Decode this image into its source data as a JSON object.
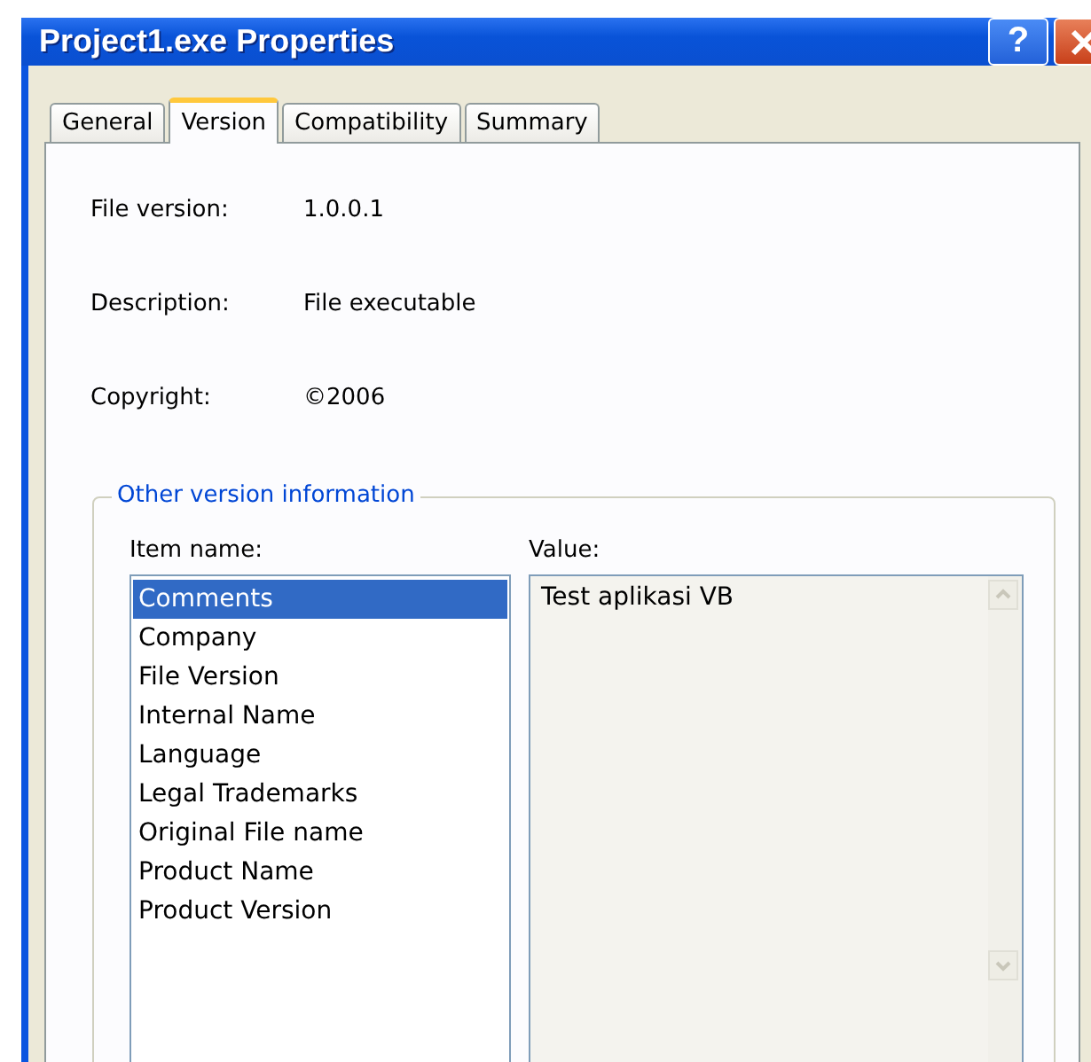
{
  "window": {
    "title": "Project1.exe Properties",
    "help_button": "?"
  },
  "tabs": [
    {
      "label": "General",
      "selected": false
    },
    {
      "label": "Version",
      "selected": true
    },
    {
      "label": "Compatibility",
      "selected": false
    },
    {
      "label": "Summary",
      "selected": false
    }
  ],
  "fields": [
    {
      "label": "File version:",
      "value": "1.0.0.1"
    },
    {
      "label": "Description:",
      "value": "File executable"
    },
    {
      "label": "Copyright:",
      "value": "©2006"
    }
  ],
  "other_info": {
    "title": "Other version information",
    "item_label": "Item name:",
    "value_label": "Value:",
    "items": [
      {
        "label": "Comments",
        "selected": true
      },
      {
        "label": "Company",
        "selected": false
      },
      {
        "label": "File Version",
        "selected": false
      },
      {
        "label": "Internal Name",
        "selected": false
      },
      {
        "label": "Language",
        "selected": false
      },
      {
        "label": "Legal Trademarks",
        "selected": false
      },
      {
        "label": "Original File name",
        "selected": false
      },
      {
        "label": "Product Name",
        "selected": false
      },
      {
        "label": "Product Version",
        "selected": false
      }
    ],
    "value": "Test aplikasi VB"
  }
}
